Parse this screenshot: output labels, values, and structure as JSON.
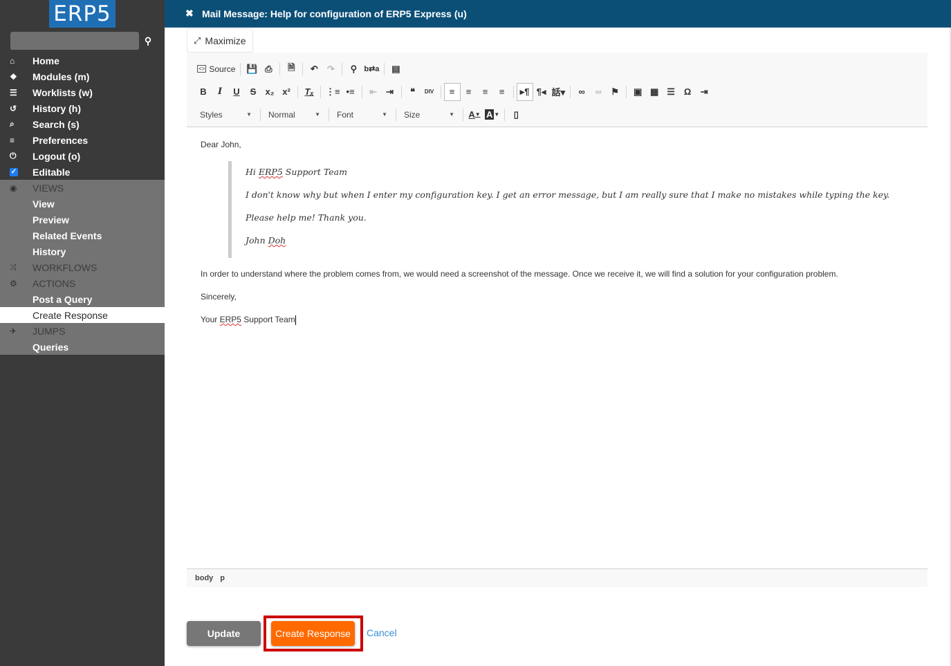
{
  "app": {
    "logo": "ERP5",
    "search_placeholder": ""
  },
  "sidebar": {
    "nav": [
      {
        "label": "Home",
        "icon": "home-icon",
        "glyph": "⌂"
      },
      {
        "label": "Modules (m)",
        "icon": "puzzle-icon",
        "glyph": "❖"
      },
      {
        "label": "Worklists (w)",
        "icon": "worklist-icon",
        "glyph": "☰"
      },
      {
        "label": "History (h)",
        "icon": "history-icon",
        "glyph": "↺"
      },
      {
        "label": "Search (s)",
        "icon": "search-icon",
        "glyph": "⌕"
      },
      {
        "label": "Preferences",
        "icon": "sliders-icon",
        "glyph": "≡"
      },
      {
        "label": "Logout (o)",
        "icon": "power-icon",
        "glyph": "⏻"
      },
      {
        "label": "Editable",
        "icon": "checkbox-icon",
        "checked": true
      }
    ],
    "views": {
      "heading": "VIEWS",
      "icon_glyph": "◉",
      "items": [
        "View",
        "Preview",
        "Related Events",
        "History"
      ]
    },
    "workflows": {
      "heading": "WORKFLOWS",
      "icon_glyph": "⤨"
    },
    "actions": {
      "heading": "ACTIONS",
      "icon_glyph": "⚙",
      "items": [
        "Post a Query",
        "Create Response"
      ],
      "active": "Create Response"
    },
    "jumps": {
      "heading": "JUMPS",
      "icon_glyph": "✈",
      "items": [
        "Queries"
      ]
    }
  },
  "header": {
    "close_glyph": "✖",
    "title": "Mail Message: Help for configuration of ERP5 Express (u)"
  },
  "editor": {
    "maximize_label": "Maximize",
    "maximize_glyph": "⤢",
    "toolbar": {
      "source_label": "Source",
      "styles_label": "Styles",
      "format_label": "Normal",
      "font_label": "Font",
      "size_label": "Size"
    },
    "content": {
      "greeting": "Dear John,",
      "quote": {
        "line1_pre": "Hi ",
        "line1_spell": "ERP5",
        "line1_post": " Support Team",
        "line2": "I don't know why but when I enter my configuration key. I get an error message, but I am really sure that I make no mistakes while typing the key.",
        "line3": "Please help me! Thank you.",
        "line4_pre": "John ",
        "line4_spell": "Doh"
      },
      "body": "In order to understand where the problem comes from, we would need a screenshot of the message. Once we receive it, we will find a solution for your configuration problem.",
      "closing": "Sincerely,",
      "signature_pre": "Your ",
      "signature_spell": "ERP5",
      "signature_post": " Support Team"
    },
    "path": [
      "body",
      "p"
    ]
  },
  "actions": {
    "update_label": "Update",
    "create_label": "Create Response",
    "cancel_label": "Cancel"
  },
  "colors": {
    "header_bg": "#0b4f77",
    "logo_bg": "#1f6fb5",
    "primary_button": "#ff6a00",
    "highlight": "#cc0000",
    "link": "#3d8fd6"
  }
}
